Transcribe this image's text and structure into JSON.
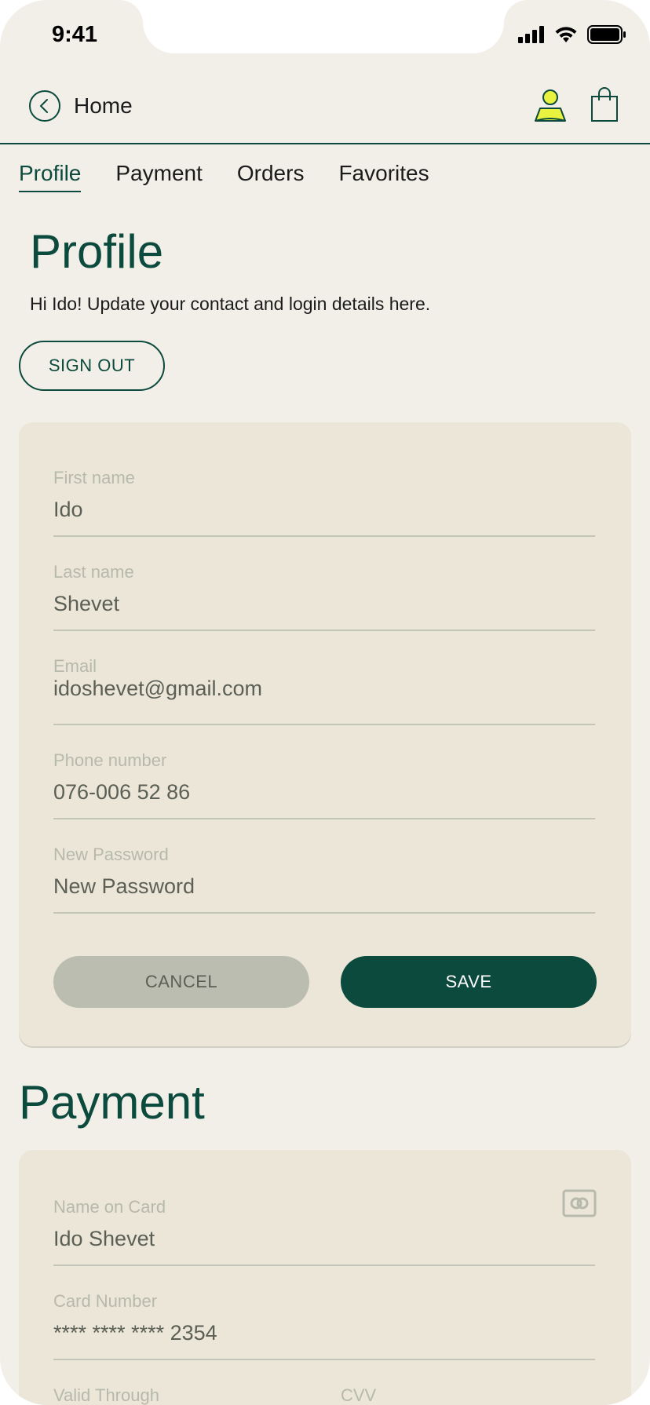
{
  "status_bar": {
    "time": "9:41"
  },
  "header": {
    "back_label": "Home"
  },
  "tabs": [
    {
      "label": "Profile",
      "active": true
    },
    {
      "label": "Payment",
      "active": false
    },
    {
      "label": "Orders",
      "active": false
    },
    {
      "label": "Favorites",
      "active": false
    }
  ],
  "profile": {
    "title": "Profile",
    "intro": "Hi Ido! Update your contact and login details here.",
    "sign_out_label": "SIGN OUT",
    "fields": [
      {
        "label": "First name",
        "value": "Ido"
      },
      {
        "label": "Last name",
        "value": "Shevet"
      },
      {
        "label": "Email",
        "value": "idoshevet@gmail.com"
      },
      {
        "label": "Phone number",
        "value": "076-006 52 86"
      },
      {
        "label": "New Password",
        "value": "New Password"
      }
    ],
    "cancel_label": "CANCEL",
    "save_label": "SAVE"
  },
  "payment": {
    "title": "Payment",
    "fields": [
      {
        "label": "Name on Card",
        "value": "Ido Shevet"
      },
      {
        "label": "Card Number",
        "value": "**** **** **** 2354"
      }
    ],
    "valid_through_label": "Valid Through",
    "cvv_label": "CVV"
  },
  "colors": {
    "background": "#f1efe8",
    "card": "#ebe6d8",
    "accent": "#0b4a3c",
    "user_icon": "#e9f23f"
  }
}
